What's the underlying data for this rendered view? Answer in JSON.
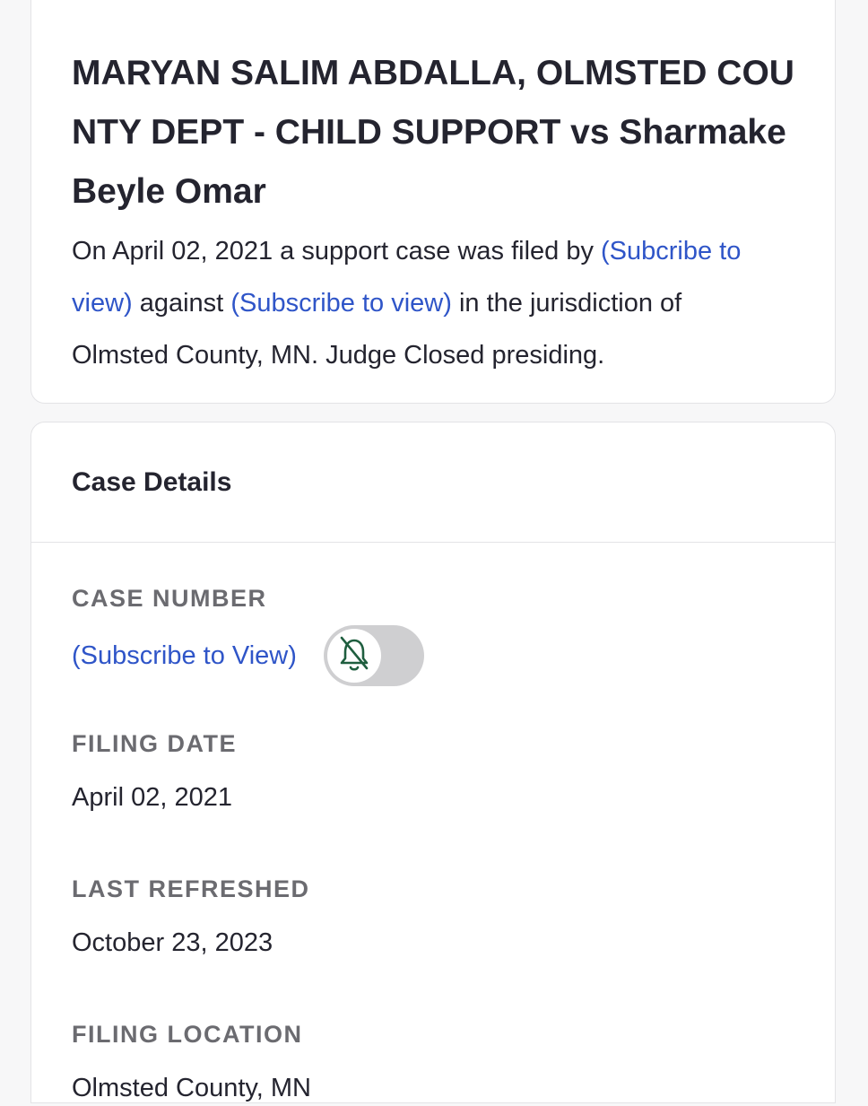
{
  "summary": {
    "title": "MARYAN SALIM ABDALLA, OLMSTED COUNTY DEPT - CHILD SUPPORT vs Sharmake Beyle Omar",
    "sentence_part1": "On April 02, 2021 a support case was filed by ",
    "plaintiff_link": "(Subcribe to view)",
    "sentence_part2": " against ",
    "defendant_link": "(Subscribe to view)",
    "sentence_part3": " in the jurisdiction of Olmsted County, MN. Judge Closed presiding."
  },
  "details": {
    "heading": "Case Details",
    "case_number": {
      "label": "CASE NUMBER",
      "link": "(Subscribe to View)"
    },
    "alert_toggle": {
      "icon": "bell-off-icon",
      "state": "off"
    },
    "filing_date": {
      "label": "FILING DATE",
      "value": "April 02, 2021"
    },
    "last_refreshed": {
      "label": "LAST REFRESHED",
      "value": "October 23, 2023"
    },
    "filing_location": {
      "label": "FILING LOCATION",
      "value": "Olmsted County, MN"
    }
  },
  "colors": {
    "link": "#2f55c8",
    "icon_green": "#1f5e3f",
    "toggle_track": "#cfcfd1"
  }
}
